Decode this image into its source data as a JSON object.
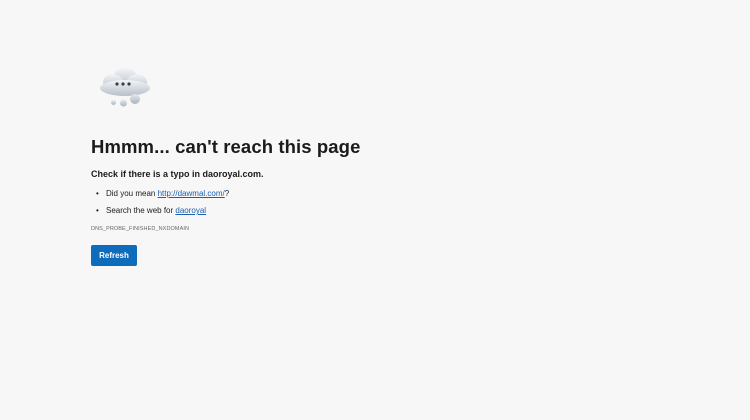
{
  "icon": {
    "name": "thinking-cloud-icon"
  },
  "colors": {
    "background": "#f7f7f7",
    "button": "#0f6cbd",
    "link": "#1a5fb4",
    "text": "#1b1b1b"
  },
  "error": {
    "title": "Hmmm... can't reach this page",
    "subtitle": "Check if there is a typo in daoroyal.com.",
    "suggestions": [
      {
        "prefix": "Did you mean ",
        "link": "http://dawmal.com/",
        "suffix": "?"
      },
      {
        "prefix": "Search the web for ",
        "link": "daoroyal",
        "suffix": ""
      }
    ],
    "code": "DNS_PROBE_FINISHED_NXDOMAIN"
  },
  "actions": {
    "refresh_label": "Refresh"
  }
}
